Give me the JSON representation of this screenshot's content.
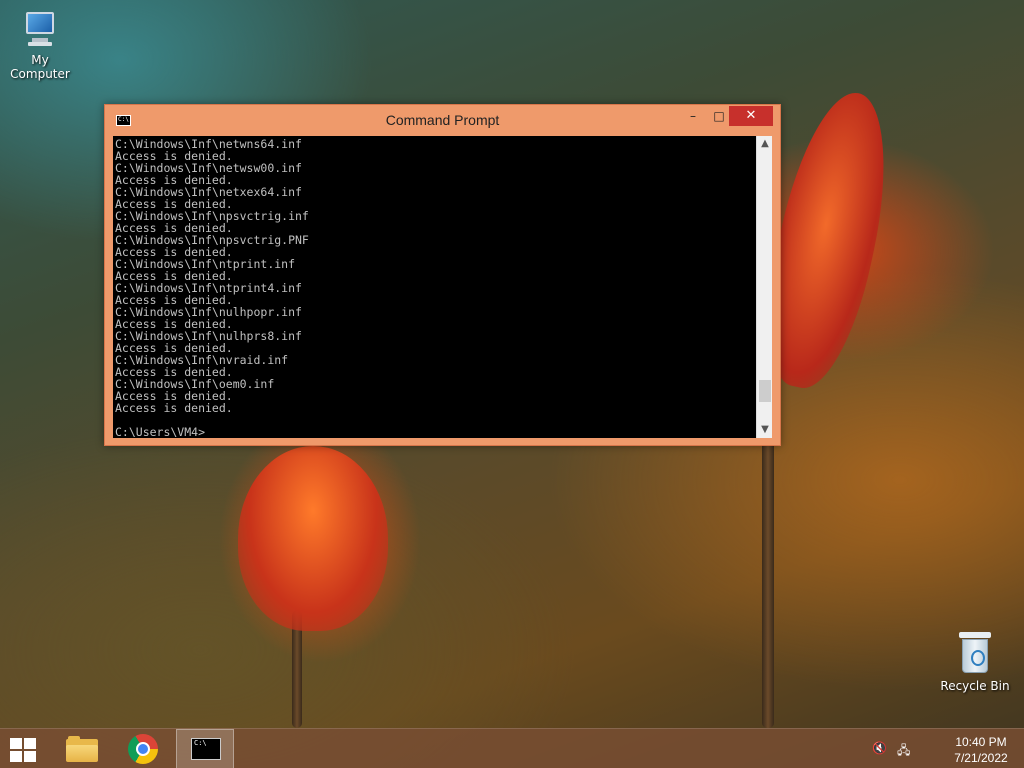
{
  "desktop": {
    "icons": [
      {
        "label": "My Computer"
      },
      {
        "label": "Recycle Bin"
      }
    ]
  },
  "window": {
    "title": "Command Prompt",
    "title_icon_text": "C:\\",
    "buttons": {
      "minimize": "–",
      "maximize": "□",
      "close": "✕"
    },
    "console_lines": [
      "C:\\Windows\\Inf\\netwns64.inf",
      "Access is denied.",
      "C:\\Windows\\Inf\\netwsw00.inf",
      "Access is denied.",
      "C:\\Windows\\Inf\\netxex64.inf",
      "Access is denied.",
      "C:\\Windows\\Inf\\npsvctrig.inf",
      "Access is denied.",
      "C:\\Windows\\Inf\\npsvctrig.PNF",
      "Access is denied.",
      "C:\\Windows\\Inf\\ntprint.inf",
      "Access is denied.",
      "C:\\Windows\\Inf\\ntprint4.inf",
      "Access is denied.",
      "C:\\Windows\\Inf\\nulhpopr.inf",
      "Access is denied.",
      "C:\\Windows\\Inf\\nulhprs8.inf",
      "Access is denied.",
      "C:\\Windows\\Inf\\nvraid.inf",
      "Access is denied.",
      "C:\\Windows\\Inf\\oem0.inf",
      "Access is denied.",
      "Access is denied.",
      "",
      "C:\\Users\\VM4>"
    ],
    "scroll_position": 0.92
  },
  "taskbar": {
    "pinned": [
      {
        "name": "file-explorer",
        "icon": "folder-icon"
      },
      {
        "name": "chrome",
        "icon": "chrome-icon"
      },
      {
        "name": "command-prompt",
        "icon": "cmd-icon",
        "active": true
      }
    ],
    "tray": {
      "volume_icon": "speaker-muted-icon",
      "network_icon": "network-icon",
      "time": "10:40 PM",
      "date": "7/21/2022"
    }
  }
}
